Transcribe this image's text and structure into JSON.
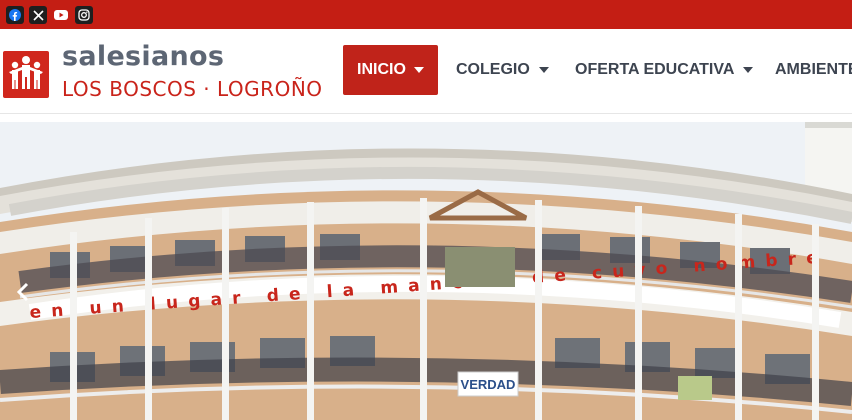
{
  "social": {
    "facebook_icon": "facebook-icon",
    "x_icon": "x-twitter-icon",
    "youtube_icon": "youtube-icon",
    "instagram_icon": "instagram-icon"
  },
  "brand": {
    "name": "salesianos",
    "subtitle": "LOS BOSCOS · LOGROÑO",
    "logo_icon": "salesianos-logo-icon"
  },
  "nav": {
    "items": [
      {
        "label": "INICIO",
        "active": true
      },
      {
        "label": "COLEGIO",
        "active": false
      },
      {
        "label": "OFERTA EDUCATIVA",
        "active": false
      },
      {
        "label": "AMBIENTE",
        "active": false
      }
    ]
  },
  "hero": {
    "banner_text": "en un lugar de la mancha  de cuyo nombre",
    "sign_text": "VERDAD",
    "prev_icon": "chevron-left-icon"
  },
  "colors": {
    "brand_red": "#c41e14",
    "nav_active_bg": "#c0231a",
    "brand_gray": "#5d6674"
  }
}
